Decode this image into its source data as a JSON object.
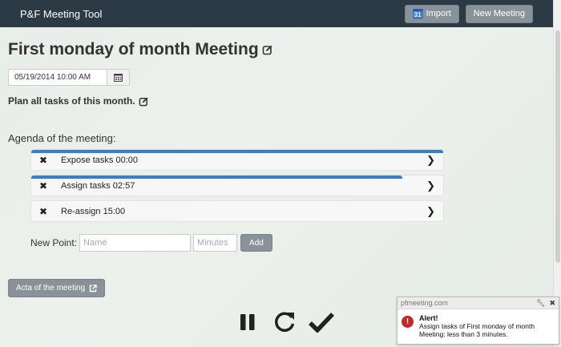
{
  "navbar": {
    "brand": "P&F Meeting Tool",
    "import_icon_text": "31",
    "import_label": "Import",
    "new_meeting_label": "New Meeting"
  },
  "meeting": {
    "title": "First monday of month Meeting",
    "datetime": "05/19/2014 10:00 AM",
    "subtitle": "Plan all tasks of this month."
  },
  "agenda": {
    "label": "Agenda of the meeting:",
    "items": [
      {
        "label": "Expose tasks 00:00",
        "progress": 1.0
      },
      {
        "label": "Assign tasks 02:57",
        "progress": 0.9
      },
      {
        "label": "Re-assign 15:00",
        "progress": 0.0
      }
    ]
  },
  "new_point": {
    "label": "New Point:",
    "name_placeholder": "Name",
    "minutes_placeholder": "Minutes",
    "add_label": "Add"
  },
  "acta": {
    "label": "Acta of the meeting"
  },
  "controls": {
    "icons": [
      "pause-icon",
      "refresh-icon",
      "check-icon"
    ]
  },
  "notification": {
    "source": "pfmeeting.com",
    "title": "Alert!",
    "message": "Assign tasks of First monday of month Meeting: less than 3 minutes."
  },
  "colors": {
    "navbar": "#2b3a45",
    "progress": "#3b7bd4",
    "button": "#8a9299",
    "alert": "#c62828"
  }
}
